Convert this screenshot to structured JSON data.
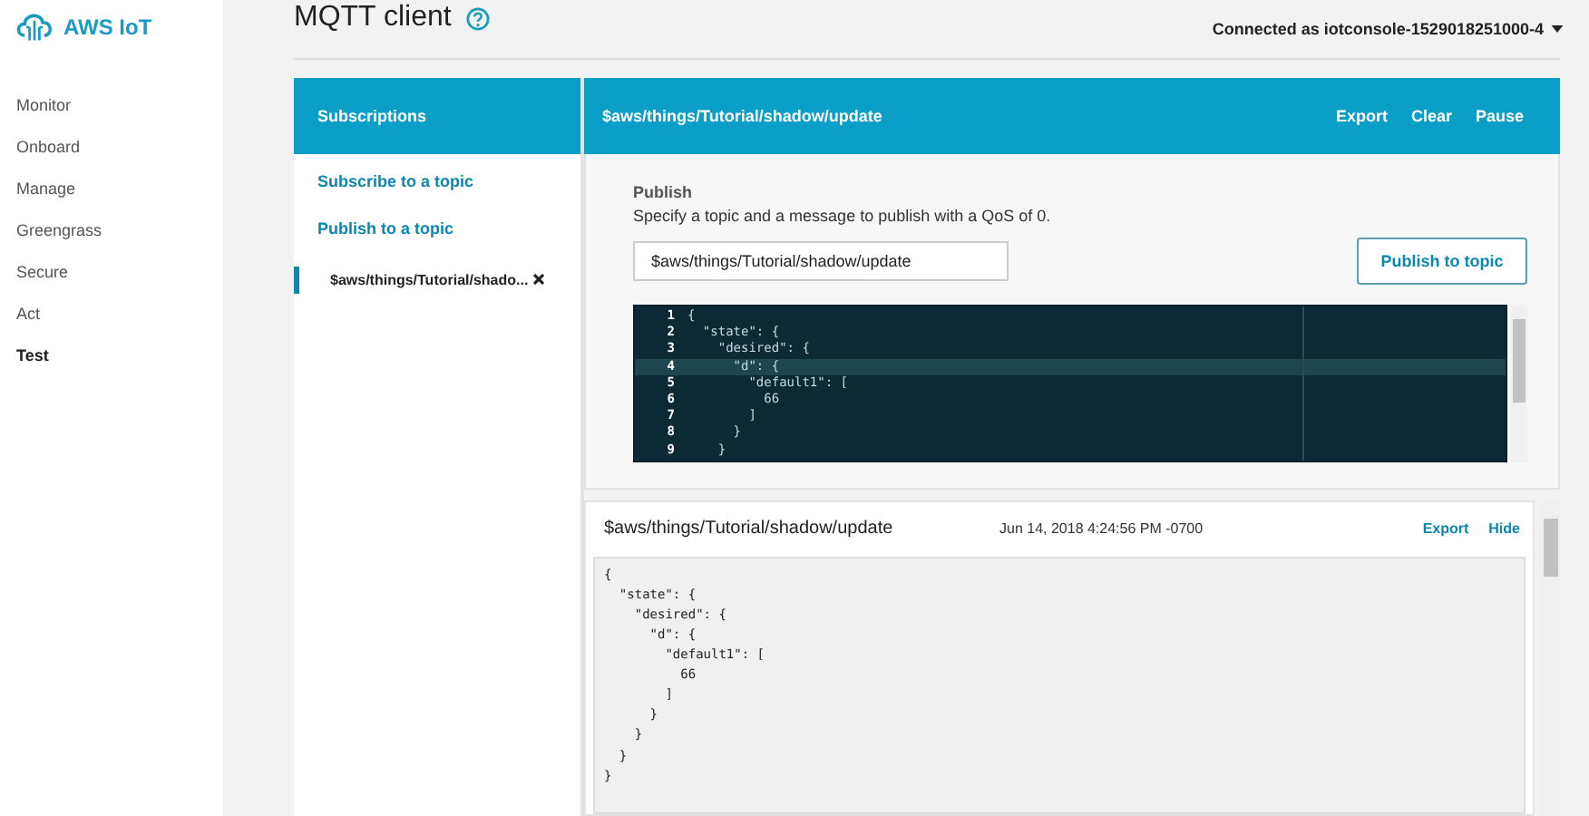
{
  "logo": {
    "text": "AWS IoT"
  },
  "nav": [
    {
      "label": "Monitor",
      "selected": false
    },
    {
      "label": "Onboard",
      "selected": false
    },
    {
      "label": "Manage",
      "selected": false
    },
    {
      "label": "Greengrass",
      "selected": false
    },
    {
      "label": "Secure",
      "selected": false
    },
    {
      "label": "Act",
      "selected": false
    },
    {
      "label": "Test",
      "selected": true
    }
  ],
  "page": {
    "title": "MQTT client",
    "connection": "Connected as iotconsole-1529018251000-4"
  },
  "subscriptions": {
    "title": "Subscriptions",
    "actions": [
      "Subscribe to a topic",
      "Publish to a topic"
    ],
    "items": [
      {
        "topic": "$aws/things/Tutorial/shado...",
        "selected": true
      }
    ]
  },
  "topic_panel": {
    "title": "$aws/things/Tutorial/shadow/update",
    "actions": [
      "Export",
      "Clear",
      "Pause"
    ]
  },
  "publish": {
    "heading": "Publish",
    "description": "Specify a topic and a message to publish with a QoS of 0.",
    "topic_value": "$aws/things/Tutorial/shadow/update",
    "button": "Publish to topic"
  },
  "editor": {
    "lines": [
      {
        "number": "1",
        "text": "{",
        "active": false
      },
      {
        "number": "2",
        "text": "  \"state\": {",
        "active": false
      },
      {
        "number": "3",
        "text": "    \"desired\": {",
        "active": false
      },
      {
        "number": "4",
        "text": "      \"d\": {",
        "active": true
      },
      {
        "number": "5",
        "text": "        \"default1\": [",
        "active": false
      },
      {
        "number": "6",
        "text": "          66",
        "active": false
      },
      {
        "number": "7",
        "text": "        ]",
        "active": false
      },
      {
        "number": "8",
        "text": "      }",
        "active": false
      },
      {
        "number": "9",
        "text": "    }",
        "active": false
      }
    ]
  },
  "message": {
    "topic": "$aws/things/Tutorial/shadow/update",
    "time": "Jun 14, 2018 4:24:56 PM -0700",
    "actions": [
      "Export",
      "Hide"
    ],
    "body": "{\n  \"state\": {\n    \"desired\": {\n      \"d\": {\n        \"default1\": [\n          66\n        ]\n      }\n    }\n  }\n}"
  }
}
